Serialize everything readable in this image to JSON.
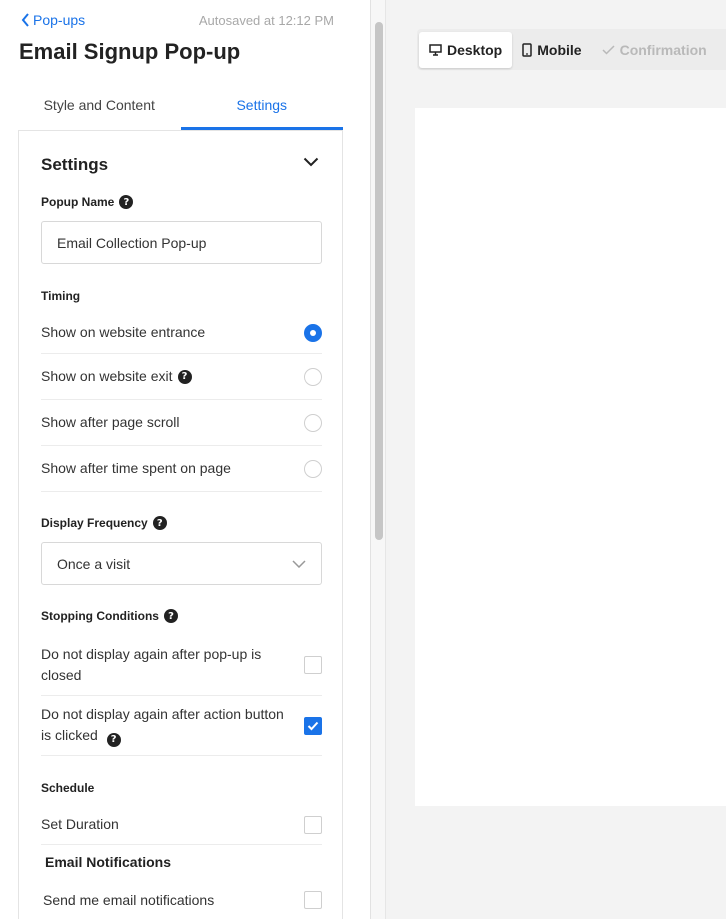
{
  "header": {
    "back_label": "Pop-ups",
    "autosave": "Autosaved at 12:12 PM",
    "title": "Email Signup Pop-up"
  },
  "tabs": [
    {
      "label": "Style and Content",
      "active": false
    },
    {
      "label": "Settings",
      "active": true
    }
  ],
  "settings": {
    "heading": "Settings",
    "popup_name": {
      "label": "Popup Name",
      "value": "Email Collection Pop-up"
    },
    "timing": {
      "label": "Timing",
      "options": [
        {
          "label": "Show on website entrance",
          "selected": true
        },
        {
          "label": "Show on website exit",
          "selected": false
        },
        {
          "label": "Show after page scroll",
          "selected": false
        },
        {
          "label": "Show after time spent on page",
          "selected": false
        }
      ]
    },
    "display_frequency": {
      "label": "Display Frequency",
      "value": "Once a visit"
    },
    "stopping_conditions": {
      "label": "Stopping Conditions",
      "options": [
        {
          "label": "Do not display again after pop-up is closed",
          "checked": false
        },
        {
          "label": "Do not display again after action button is clicked",
          "checked": true
        }
      ]
    },
    "schedule": {
      "label": "Schedule",
      "set_duration": "Set Duration",
      "set_duration_checked": false
    },
    "email_notifications": {
      "label": "Email Notifications",
      "send": "Send me email notifications",
      "send_checked": false
    }
  },
  "preview": {
    "modes": [
      {
        "label": "Desktop",
        "icon": "desktop-icon",
        "state": "active"
      },
      {
        "label": "Mobile",
        "icon": "mobile-icon",
        "state": "normal"
      },
      {
        "label": "Confirmation",
        "icon": "checkmark-icon",
        "state": "disabled"
      }
    ]
  },
  "colors": {
    "accent": "#1a73e8",
    "help_icon": "#222222",
    "disabled_text": "#b9b9b9"
  }
}
